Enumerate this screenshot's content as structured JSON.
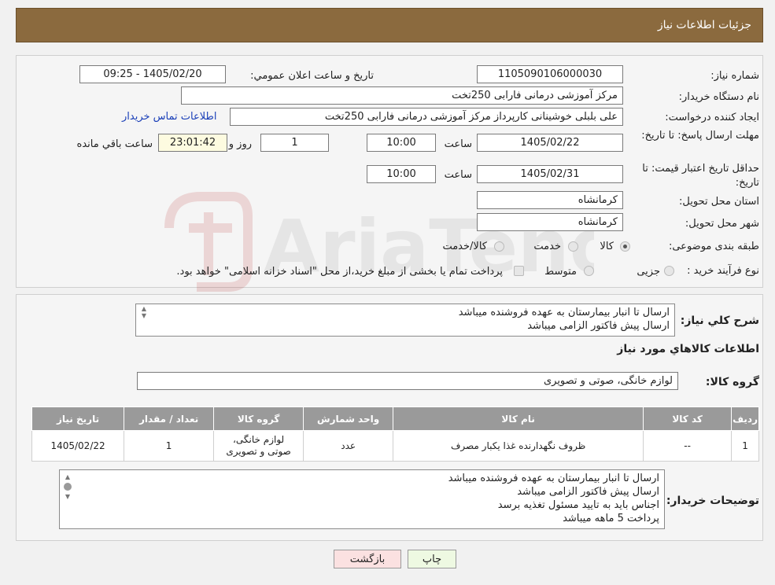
{
  "header": {
    "title": "جزئیات اطلاعات نیاز"
  },
  "watermark": {
    "text": "AriaTender.neT"
  },
  "form": {
    "need_number": {
      "label": "شماره نیاز:",
      "value": "1105090106000030"
    },
    "announce": {
      "label": "تاریخ و ساعت اعلان عمومي:",
      "value": "1405/02/20 - 09:25"
    },
    "buyer_org": {
      "label": "نام دستگاه خریدار:",
      "value": "مرکز آموزشی  درمانی فارابی 250تخت"
    },
    "requester": {
      "label": "ایجاد کننده درخواست:",
      "value": "علی بلبلی خوشینانی کارپرداز مرکز آموزشی  درمانی فارابی 250تخت"
    },
    "contact_link": "اطلاعات تماس خریدار",
    "reply_deadline": {
      "label": "مهلت ارسال پاسخ: تا تاریخ:",
      "date": "1405/02/22",
      "time_label": "ساعت",
      "time": "10:00",
      "days": "1",
      "days_label": "روز و",
      "remaining": "23:01:42",
      "remaining_label": "ساعت باقي مانده"
    },
    "price_validity": {
      "label": "حداقل تاریخ اعتبار قیمت: تا تاریخ:",
      "date": "1405/02/31",
      "time_label": "ساعت",
      "time": "10:00"
    },
    "province": {
      "label": "استان محل تحویل:",
      "value": "کرمانشاه"
    },
    "city": {
      "label": "شهر محل تحویل:",
      "value": "کرمانشاه"
    },
    "category": {
      "label": "طبقه بندی موضوعی:",
      "options": [
        "کالا",
        "خدمت",
        "کالا/خدمت"
      ],
      "selected": 0
    },
    "process": {
      "label": "نوع فرآیند خرید :",
      "options": [
        "جزیی",
        "متوسط"
      ],
      "note": "پرداخت تمام یا بخشی از مبلغ خرید،از محل \"اسناد خزانه اسلامی\" خواهد بود."
    }
  },
  "description": {
    "label": "شرح کلي نیاز:",
    "lines": [
      "ارسال تا انبار بیمارستان به عهده فروشنده میباشد",
      "ارسال پیش فاکتور الزامی میباشد"
    ]
  },
  "goods": {
    "section_title": "اطلاعات کالاهاي مورد نياز",
    "group_label": "گروه کالا:",
    "group_value": "لوازم خانگی، صوتی و تصویری",
    "columns": [
      "ردیف",
      "کد کالا",
      "نام کالا",
      "واحد شمارش",
      "گروه کالا",
      "تعداد / مقدار",
      "تاریخ نیاز"
    ],
    "rows": [
      [
        "1",
        "--",
        "ظروف نگهدارنده غذا یکبار مصرف",
        "عدد",
        "لوازم خانگی، صوتی و تصویری",
        "1",
        "1405/02/22"
      ]
    ]
  },
  "buyer_notes": {
    "label": "توضیحات خریدار:",
    "lines": [
      "ارسال تا انبار بیمارستان به عهده فروشنده میباشد",
      "ارسال پیش فاکتور الزامی میباشد",
      "اجناس باید به تایید مسئول تغذیه برسد",
      "پرداخت 5 ماهه میباشد"
    ]
  },
  "buttons": {
    "print": "چاپ",
    "back": "بازگشت"
  },
  "colors": {
    "header_bg": "#8b6a3e",
    "print_btn_bg": "#eef9e2",
    "back_btn_bg": "#fbe1e1",
    "link": "#1a3fb8"
  }
}
